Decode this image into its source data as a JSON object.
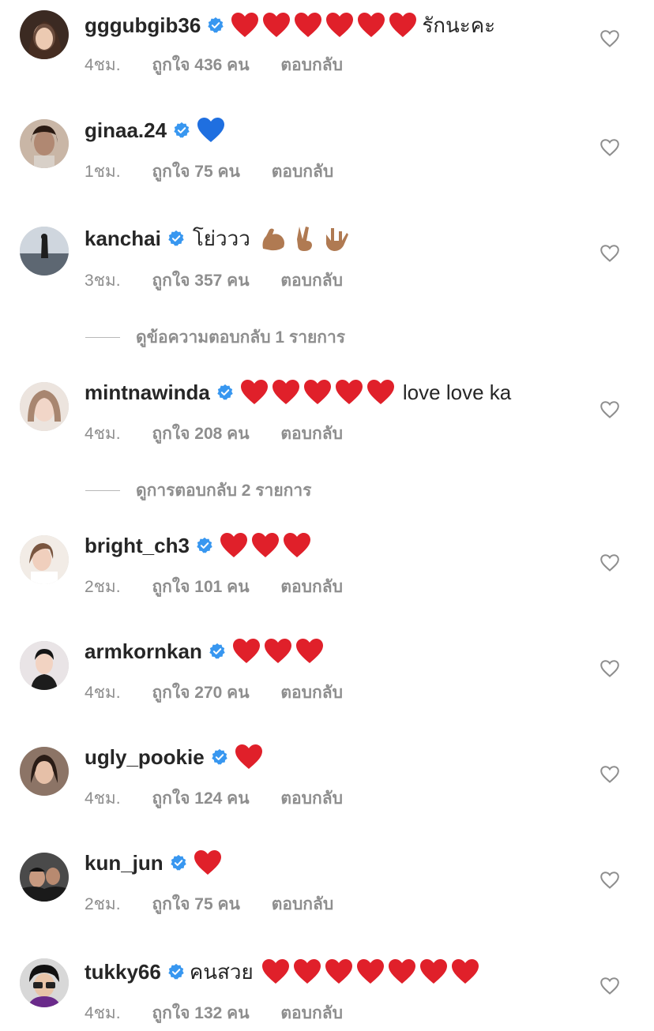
{
  "comments": [
    {
      "username": "gggubgib36",
      "text_after": "รักนะคะ",
      "hearts": 6,
      "time": "4ชม.",
      "likes": "ถูกใจ 436 คน",
      "reply": "ตอบกลับ",
      "avatar_color": "#6b4a3a"
    },
    {
      "username": "ginaa.24",
      "blue_heart": true,
      "time": "1ชม.",
      "likes": "ถูกใจ 75 คน",
      "reply": "ตอบกลับ",
      "avatar_color": "#a38a78"
    },
    {
      "username": "kanchai",
      "text": "โย่ววว",
      "emojis": [
        "flexed-biceps",
        "victory-hand",
        "love-you-gesture"
      ],
      "time": "3ชม.",
      "likes": "ถูกใจ 357 คน",
      "reply": "ตอบกลับ",
      "avatar_color": "#7a8490"
    },
    {
      "username": "mintnawinda",
      "hearts": 5,
      "text_after": "love love ka",
      "time": "4ชม.",
      "likes": "ถูกใจ 208 คน",
      "reply": "ตอบกลับ",
      "avatar_color": "#d9c3b8"
    },
    {
      "username": "bright_ch3",
      "hearts": 3,
      "time": "2ชม.",
      "likes": "ถูกใจ 101 คน",
      "reply": "ตอบกลับ",
      "avatar_color": "#e4d3c8"
    },
    {
      "username": "armkornkan",
      "hearts": 3,
      "time": "4ชม.",
      "likes": "ถูกใจ 270 คน",
      "reply": "ตอบกลับ",
      "avatar_color": "#3a3a3a"
    },
    {
      "username": "ugly_pookie",
      "hearts": 1,
      "time": "4ชม.",
      "likes": "ถูกใจ 124 คน",
      "reply": "ตอบกลับ",
      "avatar_color": "#8a6a5a"
    },
    {
      "username": "kun_jun",
      "hearts": 1,
      "time": "2ชม.",
      "likes": "ถูกใจ 75 คน",
      "reply": "ตอบกลับ",
      "avatar_color": "#2e2e2e"
    },
    {
      "username": "tukky66",
      "text": "คนสวย",
      "hearts": 7,
      "time": "4ชม.",
      "likes": "ถูกใจ 132 คน",
      "reply": "ตอบกลับ",
      "avatar_color": "#222222"
    }
  ],
  "view_replies": [
    {
      "label": "ดูข้อความตอบกลับ 1 รายการ"
    },
    {
      "label": "ดูการตอบกลับ 2 รายการ"
    }
  ],
  "colors": {
    "heart_red": "#e0202a",
    "verified_blue": "#3897f0",
    "meta_grey": "#8e8e8e",
    "text": "#262626"
  }
}
